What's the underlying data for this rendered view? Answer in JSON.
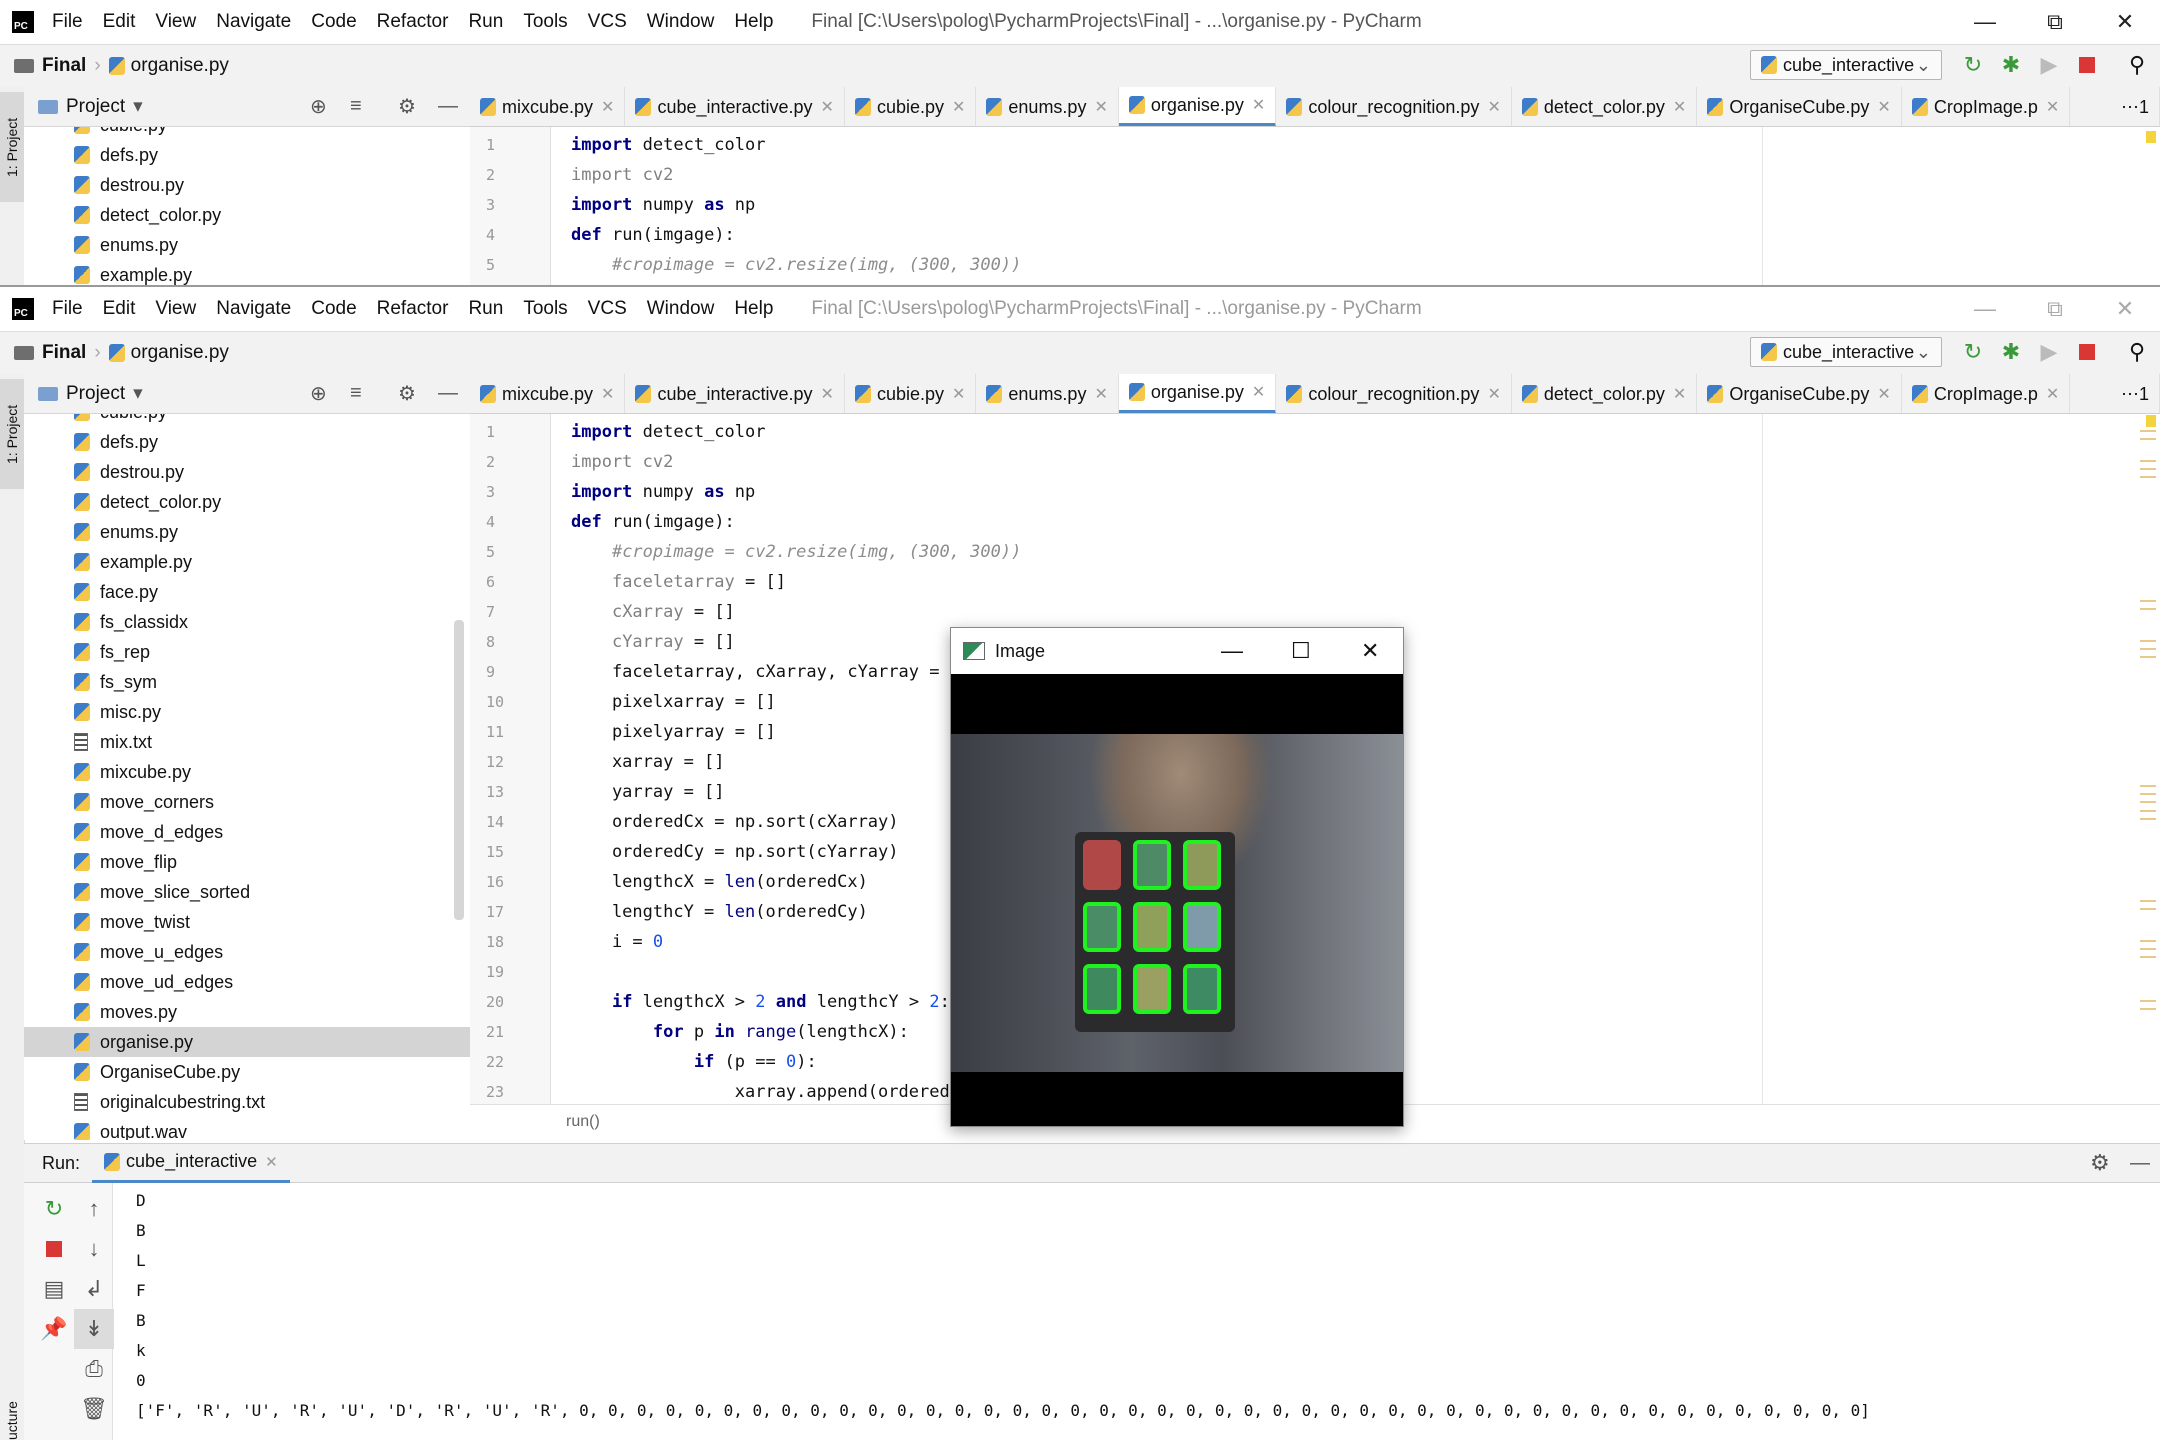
{
  "app": {
    "menu": [
      "File",
      "Edit",
      "View",
      "Navigate",
      "Code",
      "Refactor",
      "Run",
      "Tools",
      "VCS",
      "Window",
      "Help"
    ],
    "window_title": "Final [C:\\Users\\polog\\PycharmProjects\\Final] - ...\\organise.py - PyCharm",
    "breadcrumb_project": "Final",
    "breadcrumb_file": "organise.py",
    "run_config": "cube_interactive",
    "project_label": "Project",
    "side_tab_project": "1: Project",
    "side_tab_structure": "ucture"
  },
  "tabs": [
    {
      "label": "mixcube.py",
      "active": false
    },
    {
      "label": "cube_interactive.py",
      "active": false
    },
    {
      "label": "cubie.py",
      "active": false
    },
    {
      "label": "enums.py",
      "active": false
    },
    {
      "label": "organise.py",
      "active": true
    },
    {
      "label": "colour_recognition.py",
      "active": false
    },
    {
      "label": "detect_color.py",
      "active": false
    },
    {
      "label": "OrganiseCube.py",
      "active": false
    },
    {
      "label": "CropImage.p",
      "active": false
    }
  ],
  "tabs_overflow": "⋯1",
  "tree_top": [
    "cubie.py",
    "defs.py",
    "destrou.py",
    "detect_color.py",
    "enums.py",
    "example.py"
  ],
  "tree": [
    {
      "label": "cubie.py",
      "type": "py"
    },
    {
      "label": "defs.py",
      "type": "py"
    },
    {
      "label": "destrou.py",
      "type": "py"
    },
    {
      "label": "detect_color.py",
      "type": "py"
    },
    {
      "label": "enums.py",
      "type": "py"
    },
    {
      "label": "example.py",
      "type": "py"
    },
    {
      "label": "face.py",
      "type": "py"
    },
    {
      "label": "fs_classidx",
      "type": "py"
    },
    {
      "label": "fs_rep",
      "type": "py"
    },
    {
      "label": "fs_sym",
      "type": "py"
    },
    {
      "label": "misc.py",
      "type": "py"
    },
    {
      "label": "mix.txt",
      "type": "txt"
    },
    {
      "label": "mixcube.py",
      "type": "py"
    },
    {
      "label": "move_corners",
      "type": "py"
    },
    {
      "label": "move_d_edges",
      "type": "py"
    },
    {
      "label": "move_flip",
      "type": "py"
    },
    {
      "label": "move_slice_sorted",
      "type": "py"
    },
    {
      "label": "move_twist",
      "type": "py"
    },
    {
      "label": "move_u_edges",
      "type": "py"
    },
    {
      "label": "move_ud_edges",
      "type": "py"
    },
    {
      "label": "moves.py",
      "type": "py"
    },
    {
      "label": "organise.py",
      "type": "py",
      "selected": true
    },
    {
      "label": "OrganiseCube.py",
      "type": "py"
    },
    {
      "label": "originalcubestring.txt",
      "type": "txt"
    },
    {
      "label": "output.wav",
      "type": "py"
    }
  ],
  "code_lines": [
    {
      "n": "1",
      "html": "<span class='kw'>import</span> detect_color"
    },
    {
      "n": "2",
      "html": "<span class='unused'>import cv2</span>"
    },
    {
      "n": "3",
      "html": "<span class='kw'>import</span> numpy <span class='kw'>as</span> np"
    },
    {
      "n": "4",
      "html": "<span class='kw'>def</span> run(imgage):"
    },
    {
      "n": "5",
      "html": "    <span class='cm'>#cropimage = cv2.resize(img, (300, 300))</span>"
    },
    {
      "n": "6",
      "html": "    <span class='unused'>faceletarray</span> = []"
    },
    {
      "n": "7",
      "html": "    <span class='unused'>cXarray</span> = []"
    },
    {
      "n": "8",
      "html": "    <span class='unused'>cYarray</span> = []"
    },
    {
      "n": "9",
      "html": "    faceletarray, cXarray, cYarray = de"
    },
    {
      "n": "10",
      "html": "    pixelxarray = []"
    },
    {
      "n": "11",
      "html": "    pixelyarray = []"
    },
    {
      "n": "12",
      "html": "    xarray = []"
    },
    {
      "n": "13",
      "html": "    yarray = []"
    },
    {
      "n": "14",
      "html": "    orderedCx = np.sort(cXarray)"
    },
    {
      "n": "15",
      "html": "    orderedCy = np.sort(cYarray)"
    },
    {
      "n": "16",
      "html": "    lengthcX = <span class='bi'>len</span>(orderedCx)"
    },
    {
      "n": "17",
      "html": "    lengthcY = <span class='bi'>len</span>(orderedCy)"
    },
    {
      "n": "18",
      "html": "    i = <span class='num'>0</span>"
    },
    {
      "n": "19",
      "html": ""
    },
    {
      "n": "20",
      "html": "    <span class='kw'>if</span> lengthcX > <span class='num'>2</span> <span class='kw'>and</span> lengthcY > <span class='num'>2</span>:"
    },
    {
      "n": "21",
      "html": "        <span class='kw'>for</span> p <span class='kw'>in</span> <span class='bi'>range</span>(lengthcX):"
    },
    {
      "n": "22",
      "html": "            <span class='kw'>if</span> (p == <span class='num'>0</span>):"
    },
    {
      "n": "23",
      "html": "                xarray.append(orderedCx"
    }
  ],
  "code_breadcrumb": "run()",
  "run": {
    "label": "Run:",
    "tab": "cube_interactive",
    "output": [
      "D",
      "B",
      "L",
      "F",
      "B",
      "k",
      "0",
      "['F', 'R', 'U', 'R', 'U', 'D', 'R', 'U', 'R', 0, 0, 0, 0, 0, 0, 0, 0, 0, 0, 0, 0, 0, 0, 0, 0, 0, 0, 0, 0, 0, 0, 0, 0, 0, 0, 0, 0, 0, 0, 0, 0, 0, 0, 0, 0, 0, 0, 0, 0, 0, 0, 0, 0, 0]"
    ]
  },
  "image_window": {
    "title": "Image",
    "facelets": [
      {
        "color": "#b04848",
        "outlined": false
      },
      {
        "color": "#4f8a67",
        "outlined": true
      },
      {
        "color": "#8e9a5a",
        "outlined": true
      },
      {
        "color": "#4a8c66",
        "outlined": true
      },
      {
        "color": "#8ea05a",
        "outlined": true
      },
      {
        "color": "#7f9aa8",
        "outlined": true
      },
      {
        "color": "#3e8a5e",
        "outlined": true
      },
      {
        "color": "#9aa062",
        "outlined": true
      },
      {
        "color": "#3d8a63",
        "outlined": true
      }
    ]
  }
}
